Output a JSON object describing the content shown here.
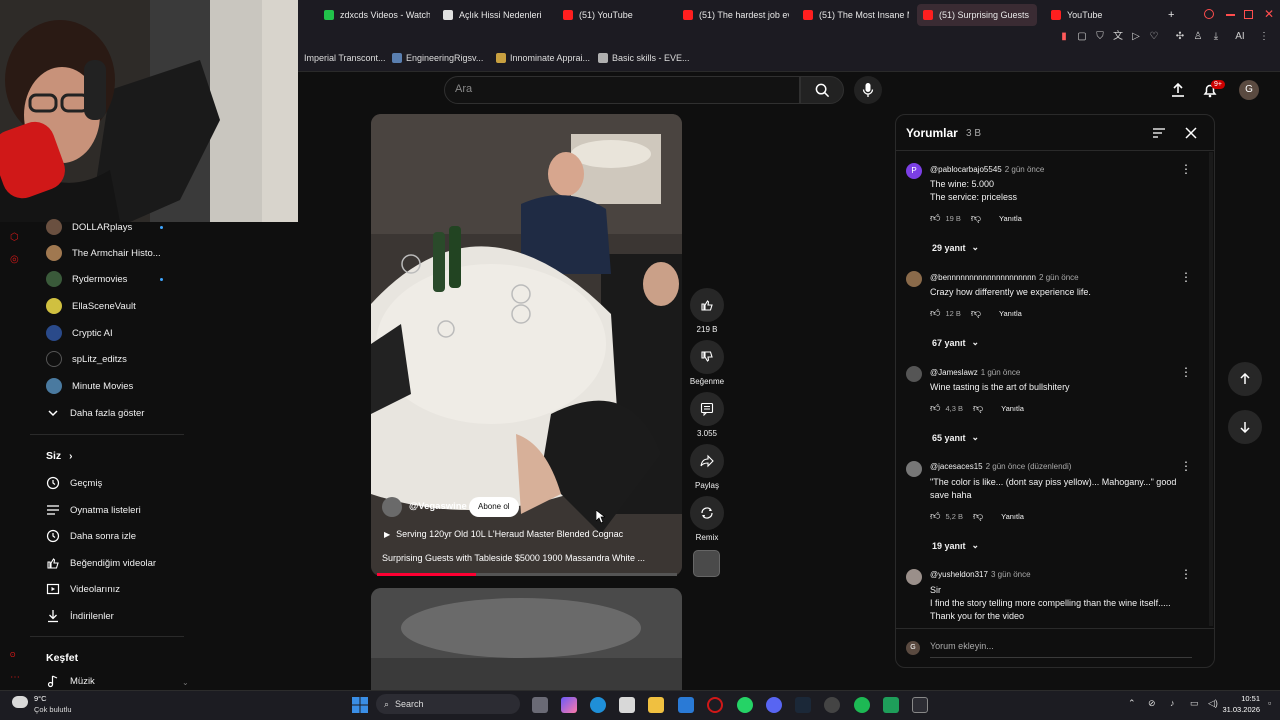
{
  "browser": {
    "tabs": [
      {
        "title": "zdxcds Videos - Watch",
        "icon": "green-k-icon"
      },
      {
        "title": "Açlık Hissi Nedenleri",
        "icon": "doc-icon"
      },
      {
        "title": "(51) YouTube",
        "icon": "youtube-icon"
      },
      {
        "title": "(51) The hardest job eve",
        "icon": "youtube-icon"
      },
      {
        "title": "(51) The Most Insane M",
        "icon": "youtube-icon"
      },
      {
        "title": "(51) Surprising Guests",
        "icon": "youtube-icon"
      },
      {
        "title": "YouTube",
        "icon": "youtube-icon"
      }
    ],
    "bookmarks": [
      "Imperial Transcont...",
      "EngineeringRigsv...",
      "Innominate Apprai...",
      "Basic skills - EVE..."
    ],
    "toolbar_text": "AI"
  },
  "header": {
    "search_placeholder": "Ara",
    "notification_count": "9+",
    "account_initial": "G"
  },
  "sidebar": {
    "subscriptions": [
      {
        "label": "DOLLARplays",
        "live": true
      },
      {
        "label": "The Armchair Histo...",
        "live": false
      },
      {
        "label": "Rydermovies",
        "live": true
      },
      {
        "label": "EllaSceneVault",
        "live": false
      },
      {
        "label": "Cryptic AI",
        "live": false
      },
      {
        "label": "spLitz_editzs",
        "live": false
      },
      {
        "label": "Minute Movies",
        "live": false
      }
    ],
    "show_more": "Daha fazla göster",
    "you_section": "Siz",
    "you_items": [
      "Geçmiş",
      "Oynatma listeleri",
      "Daha sonra izle",
      "Beğendiğim videolar",
      "Videolarınız",
      "İndirilenler"
    ],
    "explore_section": "Keşfet",
    "explore_items": [
      "Müzik"
    ]
  },
  "short": {
    "channel": "@Vegaswine",
    "subscribe": "Abone ol",
    "sound_title": "Serving 120yr Old 10L L'Heraud Master Blended Cognac",
    "title": "Surprising Guests with Tableside $5000 1900 Massandra White ...",
    "progress": 0.33,
    "actions": {
      "likes": "219 B",
      "dislike": "Beğenme",
      "comments": "3.055",
      "share": "Paylaş",
      "remix": "Remix"
    }
  },
  "comments": {
    "title": "Yorumlar",
    "count": "3 B",
    "reply_label": "Yanıtla",
    "add_placeholder": "Yorum ekleyin...",
    "items": [
      {
        "user": "@pablocarbajo5545",
        "when": "2 gün önce",
        "lines": [
          "The wine: 5.000",
          "The service: priceless"
        ],
        "likes": "19 B",
        "replies": "29 yanıt",
        "avatar_color": "#7b3fe4",
        "avatar_letter": "P"
      },
      {
        "user": "@bennnnnnnnnnnnnnnnnnnn",
        "when": "2 gün önce",
        "lines": [
          "Crazy how differently we experience life."
        ],
        "likes": "12 B",
        "replies": "67 yanıt",
        "avatar_color": "#8a6a4a",
        "avatar_letter": ""
      },
      {
        "user": "@Jameslawz",
        "when": "1 gün önce",
        "lines": [
          "Wine tasting is the art of bullshitery"
        ],
        "likes": "4,3 B",
        "replies": "65 yanıt",
        "avatar_color": "#555555",
        "avatar_letter": ""
      },
      {
        "user": "@jacesaces15",
        "when": "2 gün önce (düzenlendi)",
        "lines": [
          "\"The color is like... (dont say piss yellow)... Mahogany...\" good",
          "save haha"
        ],
        "likes": "5,2 B",
        "replies": "19 yanıt",
        "avatar_color": "#777777",
        "avatar_letter": ""
      },
      {
        "user": "@yusheldon317",
        "when": "3 gün önce",
        "lines": [
          "Sir",
          "I find the story telling more compelling than the wine itself.....",
          "Thank you for the video"
        ],
        "likes": "",
        "replies": "",
        "avatar_color": "#9a8f8a",
        "avatar_letter": ""
      }
    ],
    "self_initial": "G"
  },
  "taskbar": {
    "weather_temp": "9°C",
    "weather_desc": "Çok bulutlu",
    "search_label": "Search",
    "time": "10:51",
    "date": "31.03.2026"
  }
}
